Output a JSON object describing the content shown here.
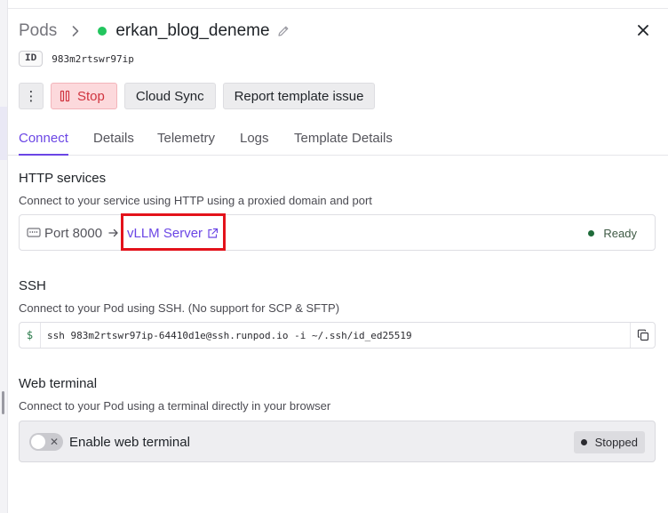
{
  "header": {
    "breadcrumb_root": "Pods",
    "pod_name": "erkan_blog_deneme",
    "id_label": "ID",
    "id_value": "983m2rtswr97ip"
  },
  "actions": {
    "more_label": "⋮",
    "stop_label": "Stop",
    "cloud_sync_label": "Cloud Sync",
    "report_label": "Report template issue"
  },
  "tabs": [
    {
      "label": "Connect",
      "active": true
    },
    {
      "label": "Details",
      "active": false
    },
    {
      "label": "Telemetry",
      "active": false
    },
    {
      "label": "Logs",
      "active": false
    },
    {
      "label": "Template Details",
      "active": false
    }
  ],
  "http": {
    "title": "HTTP services",
    "description": "Connect to your service using HTTP using a proxied domain and port",
    "port_label": "Port 8000",
    "service_link": "vLLM Server",
    "status": "Ready"
  },
  "ssh": {
    "title": "SSH",
    "description": "Connect to your Pod using SSH. (No support for SCP & SFTP)",
    "prompt": "$",
    "command": "ssh 983m2rtswr97ip-64410d1e@ssh.runpod.io -i ~/.ssh/id_ed25519"
  },
  "web_terminal": {
    "title": "Web terminal",
    "description": "Connect to your Pod using a terminal directly in your browser",
    "toggle_label": "Enable web terminal",
    "toggle_enabled": false,
    "status": "Stopped"
  },
  "colors": {
    "accent": "#6b46e5",
    "running": "#22c55e",
    "stop_bg": "#fcd9dc",
    "stop_text": "#d0343f",
    "highlight": "#e3121b"
  }
}
